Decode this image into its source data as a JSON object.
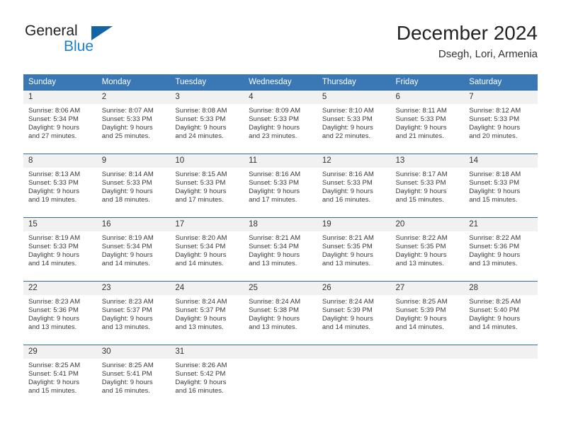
{
  "brand": {
    "name_part1": "General",
    "name_part2": "Blue",
    "flag_icon": "triangle-flag-icon"
  },
  "header": {
    "title": "December 2024",
    "subtitle": "Dsegh, Lori, Armenia"
  },
  "colors": {
    "header_blue": "#3a78b5",
    "row_border_blue": "#2f6ca8",
    "daynum_band": "#f1f1f1",
    "brand_blue": "#1b7fd4",
    "flag_blue": "#1464a5",
    "text": "#222222"
  },
  "calendar": {
    "weekday_headers": [
      "Sunday",
      "Monday",
      "Tuesday",
      "Wednesday",
      "Thursday",
      "Friday",
      "Saturday"
    ],
    "weeks": [
      [
        {
          "day": "1",
          "sunrise": "Sunrise: 8:06 AM",
          "sunset": "Sunset: 5:34 PM",
          "daylight_line1": "Daylight: 9 hours",
          "daylight_line2": "and 27 minutes."
        },
        {
          "day": "2",
          "sunrise": "Sunrise: 8:07 AM",
          "sunset": "Sunset: 5:33 PM",
          "daylight_line1": "Daylight: 9 hours",
          "daylight_line2": "and 25 minutes."
        },
        {
          "day": "3",
          "sunrise": "Sunrise: 8:08 AM",
          "sunset": "Sunset: 5:33 PM",
          "daylight_line1": "Daylight: 9 hours",
          "daylight_line2": "and 24 minutes."
        },
        {
          "day": "4",
          "sunrise": "Sunrise: 8:09 AM",
          "sunset": "Sunset: 5:33 PM",
          "daylight_line1": "Daylight: 9 hours",
          "daylight_line2": "and 23 minutes."
        },
        {
          "day": "5",
          "sunrise": "Sunrise: 8:10 AM",
          "sunset": "Sunset: 5:33 PM",
          "daylight_line1": "Daylight: 9 hours",
          "daylight_line2": "and 22 minutes."
        },
        {
          "day": "6",
          "sunrise": "Sunrise: 8:11 AM",
          "sunset": "Sunset: 5:33 PM",
          "daylight_line1": "Daylight: 9 hours",
          "daylight_line2": "and 21 minutes."
        },
        {
          "day": "7",
          "sunrise": "Sunrise: 8:12 AM",
          "sunset": "Sunset: 5:33 PM",
          "daylight_line1": "Daylight: 9 hours",
          "daylight_line2": "and 20 minutes."
        }
      ],
      [
        {
          "day": "8",
          "sunrise": "Sunrise: 8:13 AM",
          "sunset": "Sunset: 5:33 PM",
          "daylight_line1": "Daylight: 9 hours",
          "daylight_line2": "and 19 minutes."
        },
        {
          "day": "9",
          "sunrise": "Sunrise: 8:14 AM",
          "sunset": "Sunset: 5:33 PM",
          "daylight_line1": "Daylight: 9 hours",
          "daylight_line2": "and 18 minutes."
        },
        {
          "day": "10",
          "sunrise": "Sunrise: 8:15 AM",
          "sunset": "Sunset: 5:33 PM",
          "daylight_line1": "Daylight: 9 hours",
          "daylight_line2": "and 17 minutes."
        },
        {
          "day": "11",
          "sunrise": "Sunrise: 8:16 AM",
          "sunset": "Sunset: 5:33 PM",
          "daylight_line1": "Daylight: 9 hours",
          "daylight_line2": "and 17 minutes."
        },
        {
          "day": "12",
          "sunrise": "Sunrise: 8:16 AM",
          "sunset": "Sunset: 5:33 PM",
          "daylight_line1": "Daylight: 9 hours",
          "daylight_line2": "and 16 minutes."
        },
        {
          "day": "13",
          "sunrise": "Sunrise: 8:17 AM",
          "sunset": "Sunset: 5:33 PM",
          "daylight_line1": "Daylight: 9 hours",
          "daylight_line2": "and 15 minutes."
        },
        {
          "day": "14",
          "sunrise": "Sunrise: 8:18 AM",
          "sunset": "Sunset: 5:33 PM",
          "daylight_line1": "Daylight: 9 hours",
          "daylight_line2": "and 15 minutes."
        }
      ],
      [
        {
          "day": "15",
          "sunrise": "Sunrise: 8:19 AM",
          "sunset": "Sunset: 5:33 PM",
          "daylight_line1": "Daylight: 9 hours",
          "daylight_line2": "and 14 minutes."
        },
        {
          "day": "16",
          "sunrise": "Sunrise: 8:19 AM",
          "sunset": "Sunset: 5:34 PM",
          "daylight_line1": "Daylight: 9 hours",
          "daylight_line2": "and 14 minutes."
        },
        {
          "day": "17",
          "sunrise": "Sunrise: 8:20 AM",
          "sunset": "Sunset: 5:34 PM",
          "daylight_line1": "Daylight: 9 hours",
          "daylight_line2": "and 14 minutes."
        },
        {
          "day": "18",
          "sunrise": "Sunrise: 8:21 AM",
          "sunset": "Sunset: 5:34 PM",
          "daylight_line1": "Daylight: 9 hours",
          "daylight_line2": "and 13 minutes."
        },
        {
          "day": "19",
          "sunrise": "Sunrise: 8:21 AM",
          "sunset": "Sunset: 5:35 PM",
          "daylight_line1": "Daylight: 9 hours",
          "daylight_line2": "and 13 minutes."
        },
        {
          "day": "20",
          "sunrise": "Sunrise: 8:22 AM",
          "sunset": "Sunset: 5:35 PM",
          "daylight_line1": "Daylight: 9 hours",
          "daylight_line2": "and 13 minutes."
        },
        {
          "day": "21",
          "sunrise": "Sunrise: 8:22 AM",
          "sunset": "Sunset: 5:36 PM",
          "daylight_line1": "Daylight: 9 hours",
          "daylight_line2": "and 13 minutes."
        }
      ],
      [
        {
          "day": "22",
          "sunrise": "Sunrise: 8:23 AM",
          "sunset": "Sunset: 5:36 PM",
          "daylight_line1": "Daylight: 9 hours",
          "daylight_line2": "and 13 minutes."
        },
        {
          "day": "23",
          "sunrise": "Sunrise: 8:23 AM",
          "sunset": "Sunset: 5:37 PM",
          "daylight_line1": "Daylight: 9 hours",
          "daylight_line2": "and 13 minutes."
        },
        {
          "day": "24",
          "sunrise": "Sunrise: 8:24 AM",
          "sunset": "Sunset: 5:37 PM",
          "daylight_line1": "Daylight: 9 hours",
          "daylight_line2": "and 13 minutes."
        },
        {
          "day": "25",
          "sunrise": "Sunrise: 8:24 AM",
          "sunset": "Sunset: 5:38 PM",
          "daylight_line1": "Daylight: 9 hours",
          "daylight_line2": "and 13 minutes."
        },
        {
          "day": "26",
          "sunrise": "Sunrise: 8:24 AM",
          "sunset": "Sunset: 5:39 PM",
          "daylight_line1": "Daylight: 9 hours",
          "daylight_line2": "and 14 minutes."
        },
        {
          "day": "27",
          "sunrise": "Sunrise: 8:25 AM",
          "sunset": "Sunset: 5:39 PM",
          "daylight_line1": "Daylight: 9 hours",
          "daylight_line2": "and 14 minutes."
        },
        {
          "day": "28",
          "sunrise": "Sunrise: 8:25 AM",
          "sunset": "Sunset: 5:40 PM",
          "daylight_line1": "Daylight: 9 hours",
          "daylight_line2": "and 14 minutes."
        }
      ],
      [
        {
          "day": "29",
          "sunrise": "Sunrise: 8:25 AM",
          "sunset": "Sunset: 5:41 PM",
          "daylight_line1": "Daylight: 9 hours",
          "daylight_line2": "and 15 minutes."
        },
        {
          "day": "30",
          "sunrise": "Sunrise: 8:25 AM",
          "sunset": "Sunset: 5:41 PM",
          "daylight_line1": "Daylight: 9 hours",
          "daylight_line2": "and 16 minutes."
        },
        {
          "day": "31",
          "sunrise": "Sunrise: 8:26 AM",
          "sunset": "Sunset: 5:42 PM",
          "daylight_line1": "Daylight: 9 hours",
          "daylight_line2": "and 16 minutes."
        },
        {
          "day": "",
          "sunrise": "",
          "sunset": "",
          "daylight_line1": "",
          "daylight_line2": ""
        },
        {
          "day": "",
          "sunrise": "",
          "sunset": "",
          "daylight_line1": "",
          "daylight_line2": ""
        },
        {
          "day": "",
          "sunrise": "",
          "sunset": "",
          "daylight_line1": "",
          "daylight_line2": ""
        },
        {
          "day": "",
          "sunrise": "",
          "sunset": "",
          "daylight_line1": "",
          "daylight_line2": ""
        }
      ]
    ]
  }
}
